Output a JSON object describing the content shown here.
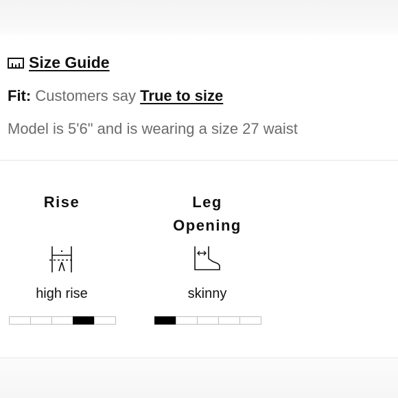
{
  "size_guide": {
    "label": "Size Guide",
    "icon": "ruler-icon"
  },
  "fit": {
    "label": "Fit:",
    "text": "Customers say",
    "link": "True to size"
  },
  "model_info": "Model is 5'6\" and is wearing a size 27 waist",
  "attributes": [
    {
      "title_lines": [
        "Rise"
      ],
      "icon": "rise-icon",
      "value": "high rise",
      "scale": {
        "segments": 5,
        "selected": 4
      }
    },
    {
      "title_lines": [
        "Leg",
        "Opening"
      ],
      "icon": "leg-opening-icon",
      "value": "skinny",
      "scale": {
        "segments": 5,
        "selected": 1
      }
    }
  ],
  "colors": {
    "text": "#111111",
    "muted": "#6b6b6b",
    "scale_fill": "#000000",
    "scale_border": "#bdbdbd"
  }
}
